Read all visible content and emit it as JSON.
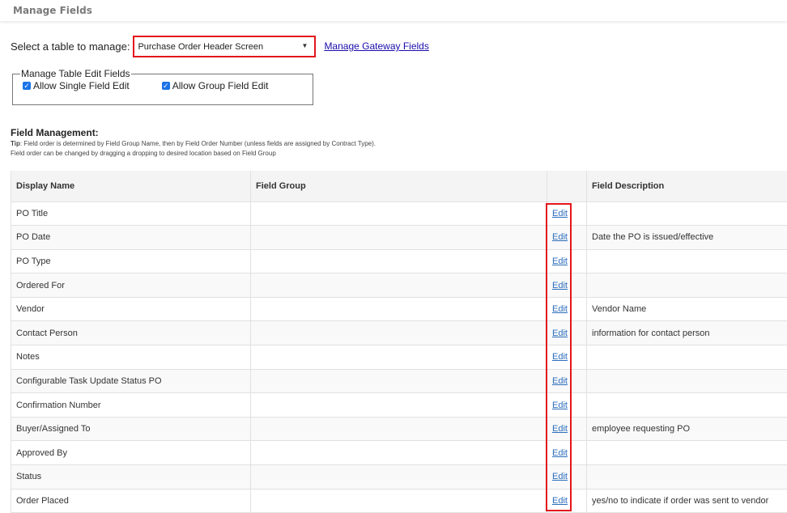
{
  "header": {
    "title": "Manage Fields"
  },
  "table_select": {
    "label": "Select a table to manage:",
    "selected": "Purchase Order Header Screen",
    "arrow_icon": "▼"
  },
  "gateway_link": "Manage Gateway Fields",
  "edit_fields": {
    "legend": "Manage Table Edit Fields",
    "options": [
      {
        "label": "Allow Single Field Edit",
        "checked": true
      },
      {
        "label": "Allow Group Field Edit",
        "checked": true
      }
    ]
  },
  "field_management": {
    "title": "Field Management:",
    "tip_label": "Tip",
    "tip_line1": ": Field order is determined by Field Group Name, then by Field Order Number (unless fields are assigned by Contract Type).",
    "tip_line2": "Field order can be changed by dragging a dropping to desired location based on Field Group"
  },
  "table": {
    "columns": [
      "Display Name",
      "Field Group",
      "",
      "Field Description"
    ],
    "edit_label": "Edit",
    "rows": [
      {
        "name": "PO Title",
        "group": "",
        "description": ""
      },
      {
        "name": "PO Date",
        "group": "",
        "description": "Date the PO is issued/effective"
      },
      {
        "name": "PO Type",
        "group": "",
        "description": ""
      },
      {
        "name": "Ordered For",
        "group": "",
        "description": ""
      },
      {
        "name": "Vendor",
        "group": "",
        "description": "Vendor Name"
      },
      {
        "name": "Contact Person",
        "group": "",
        "description": "information for contact person"
      },
      {
        "name": "Notes",
        "group": "",
        "description": ""
      },
      {
        "name": "Configurable Task Update Status PO",
        "group": "",
        "description": ""
      },
      {
        "name": "Confirmation Number",
        "group": "",
        "description": ""
      },
      {
        "name": "Buyer/Assigned To",
        "group": "",
        "description": "employee requesting PO"
      },
      {
        "name": "Approved By",
        "group": "",
        "description": ""
      },
      {
        "name": "Status",
        "group": "",
        "description": ""
      },
      {
        "name": "Order Placed",
        "group": "",
        "description": "yes/no to indicate if order was sent to vendor"
      }
    ]
  },
  "colors": {
    "highlight": "#e3161c",
    "link": "#2a6ebb",
    "header_bg": "#f4f4f4",
    "stripe_bg": "#f9f9f9"
  }
}
